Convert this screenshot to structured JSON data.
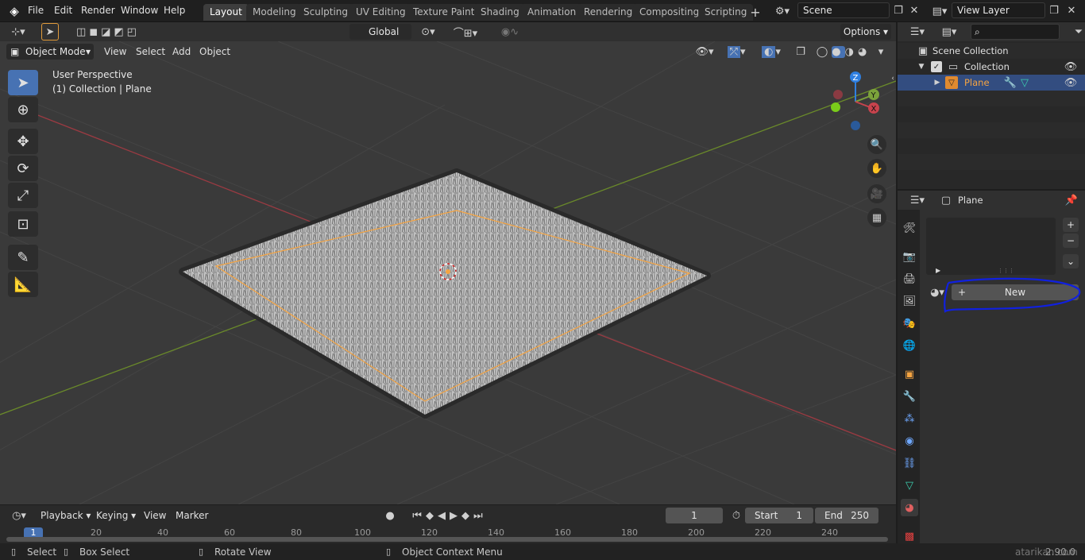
{
  "topbar": {
    "menus": [
      "File",
      "Edit",
      "Render",
      "Window",
      "Help"
    ],
    "workspaces": [
      "Layout",
      "Modeling",
      "Sculpting",
      "UV Editing",
      "Texture Paint",
      "Shading",
      "Animation",
      "Rendering",
      "Compositing",
      "Scripting"
    ],
    "scene": "Scene",
    "view_layer": "View Layer"
  },
  "tool_header": {
    "transform": "Global",
    "options": "Options"
  },
  "viewport_header": {
    "mode": "Object Mode",
    "menus": [
      "View",
      "Select",
      "Add",
      "Object"
    ]
  },
  "viewport": {
    "perspective": "User Perspective",
    "context": "(1) Collection | Plane",
    "gizmo_labels": {
      "z": "Z",
      "y": "Y",
      "x": "X"
    }
  },
  "outliner": {
    "scene_collection": "Scene Collection",
    "collection": "Collection",
    "object": "Plane"
  },
  "properties": {
    "object_name": "Plane",
    "new_button": "New"
  },
  "timeline": {
    "menus": [
      "Playback",
      "Keying",
      "View",
      "Marker"
    ],
    "current_frame": "1",
    "start_label": "Start",
    "start": "1",
    "end_label": "End",
    "end": "250",
    "ruler": [
      "1",
      "20",
      "40",
      "60",
      "80",
      "100",
      "120",
      "140",
      "160",
      "180",
      "200",
      "220",
      "240"
    ]
  },
  "statusbar": {
    "select": "Select",
    "box_select": "Box Select",
    "rotate": "Rotate View",
    "context_menu": "Object Context Menu",
    "version": "2.90.0",
    "watermark": "atarikan.com"
  },
  "colors": {
    "accent": "#4772b3",
    "selection_orange": "#f5a442",
    "annotation_blue": "#1020e0",
    "x_axis": "#c8434d",
    "y_axis": "#7ca33b",
    "z_axis": "#2f7fe0"
  }
}
